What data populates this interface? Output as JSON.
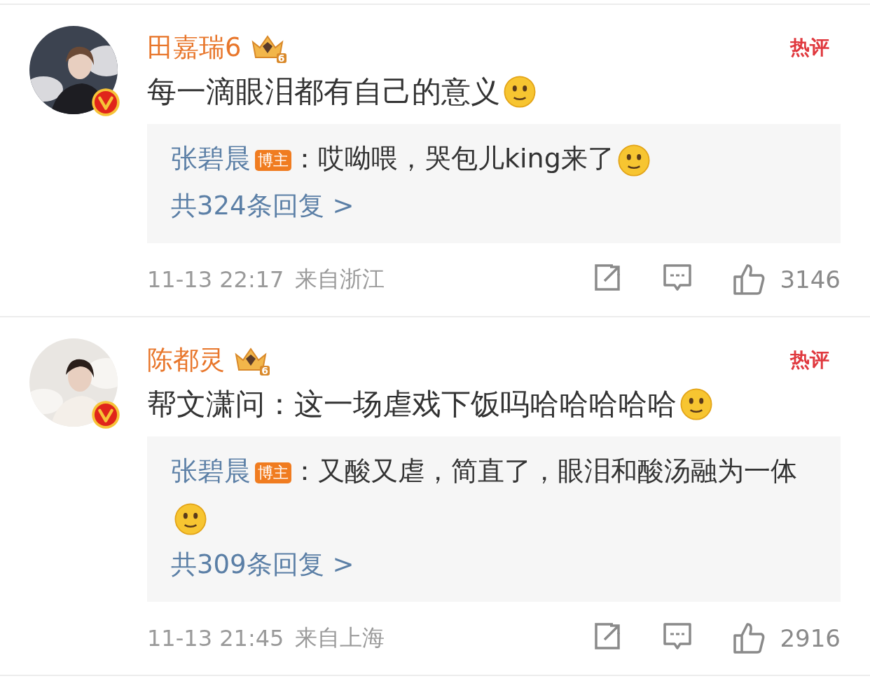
{
  "comments": [
    {
      "author": "田嘉瑞6",
      "rank_badge": "6",
      "hot_tag": "热评",
      "text": "每一滴眼泪都有自己的意义",
      "reply": {
        "author": "张碧晨",
        "author_tag": "博主",
        "text": "：哎呦喂，哭包儿king来了"
      },
      "reply_count": "共324条回复 >",
      "time": "11-13 22:17",
      "location": "来自浙江",
      "likes": "3146"
    },
    {
      "author": "陈都灵",
      "rank_badge": "6",
      "hot_tag": "热评",
      "text": "帮文潇问：这一场虐戏下饭吗哈哈哈哈哈",
      "reply": {
        "author": "张碧晨",
        "author_tag": "博主",
        "text": "：又酸又虐，简直了，眼泪和酸汤融为一体"
      },
      "reply_count": "共309条回复 >",
      "time": "11-13 21:45",
      "location": "来自上海",
      "likes": "2916"
    }
  ]
}
